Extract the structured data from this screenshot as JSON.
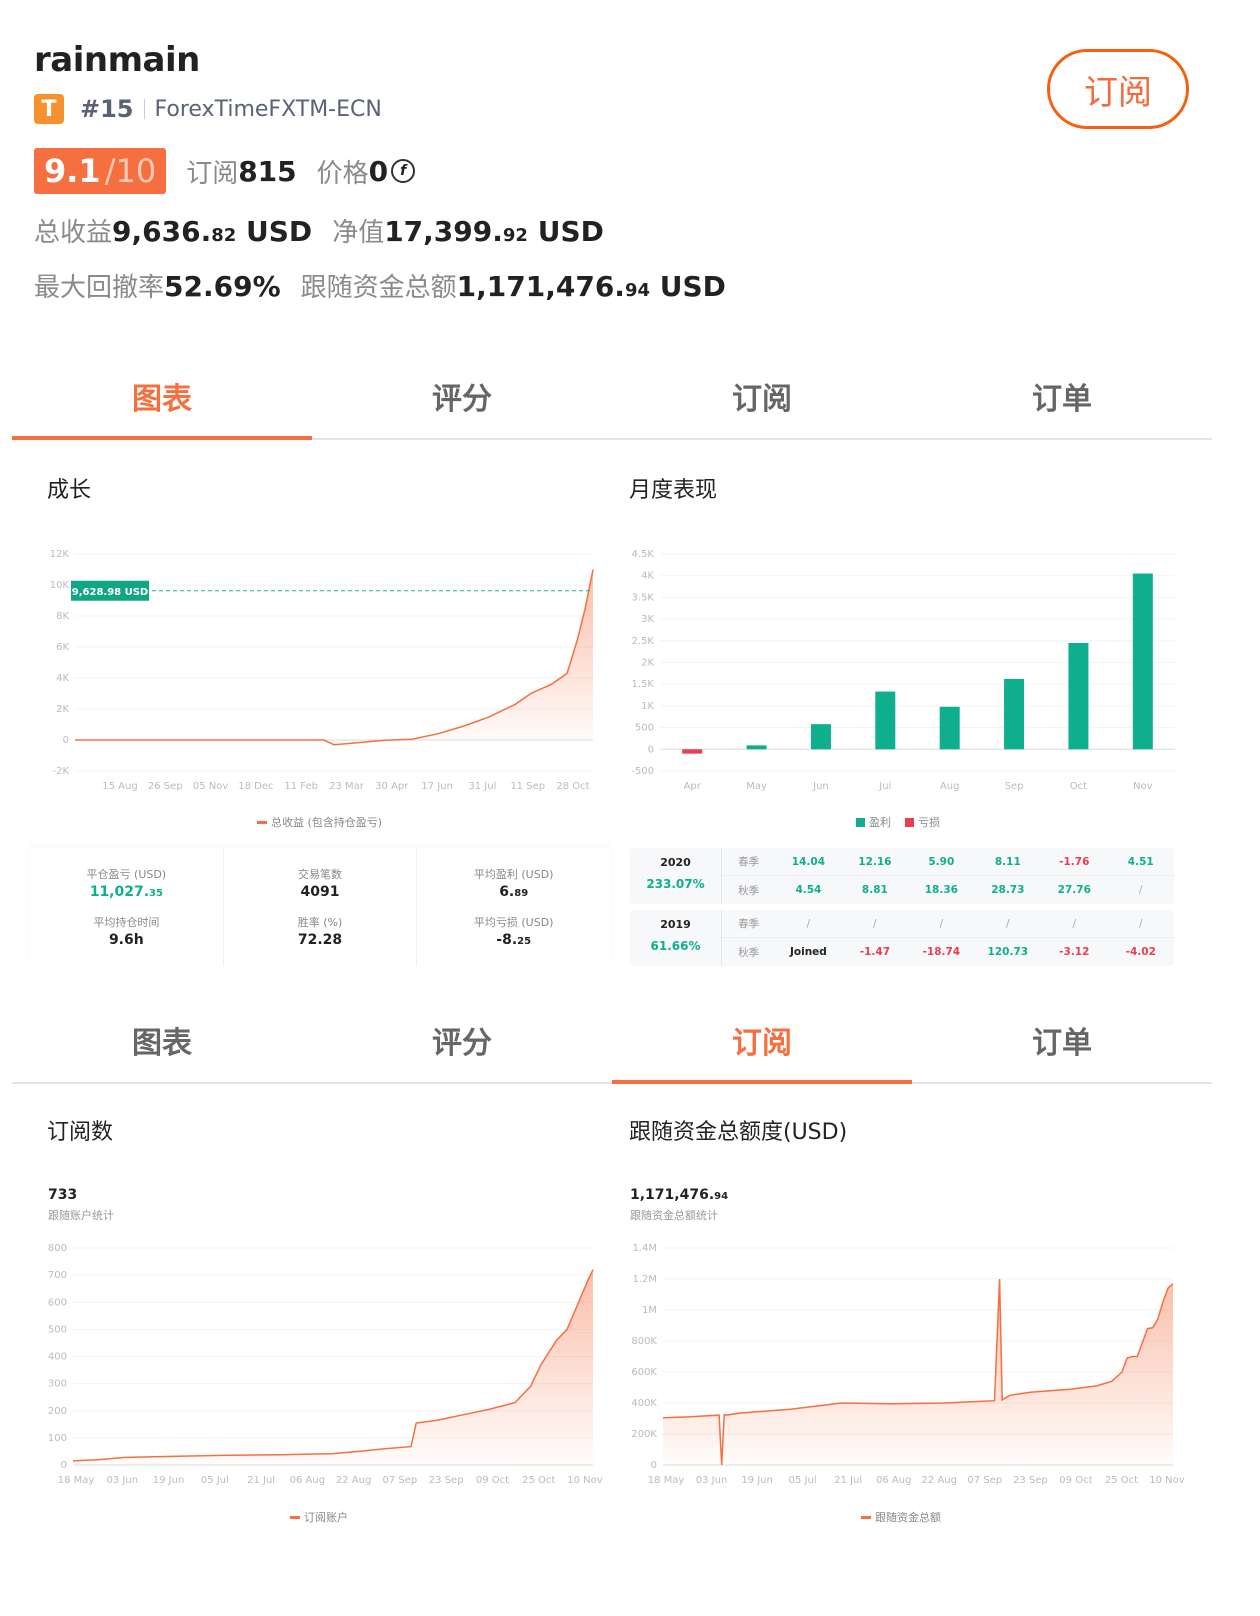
{
  "profile": {
    "username": "rainmain",
    "tier_badge": "T",
    "rank": "#15",
    "broker": "ForexTimeFXTM-ECN",
    "score": "9.1",
    "score_max": "/10",
    "subscribers_label": "订阅",
    "subscribers": "815",
    "price_label": "价格",
    "price": "0",
    "coin_icon": "f",
    "total_profit_label": "总收益",
    "total_profit_int": "9,636.",
    "total_profit_dec": "82",
    "total_profit_unit": "USD",
    "equity_label": "净值",
    "equity_int": "17,399.",
    "equity_dec": "92",
    "equity_unit": "USD",
    "max_drawdown_label": "最大回撤率",
    "max_drawdown": "52.69%",
    "follow_funds_label": "跟随资金总额",
    "follow_funds_int": "1,171,476.",
    "follow_funds_dec": "94",
    "follow_funds_unit": "USD"
  },
  "subscribe_button": "订阅",
  "tabs_top": [
    {
      "label": "图表",
      "active": true
    },
    {
      "label": "评分",
      "active": false
    },
    {
      "label": "订阅",
      "active": false
    },
    {
      "label": "订单",
      "active": false
    }
  ],
  "tabs_bottom": [
    {
      "label": "图表",
      "active": false
    },
    {
      "label": "评分",
      "active": false
    },
    {
      "label": "订阅",
      "active": true
    },
    {
      "label": "订单",
      "active": false
    }
  ],
  "sections": {
    "growth": "成长",
    "monthly": "月度表现",
    "subscriptions": "订阅数",
    "follow_funds": "跟随资金总额度(USD)"
  },
  "colors": {
    "accent": "#f56f40",
    "profit": "#0fae8d",
    "loss": "#ea3e4f"
  },
  "summary": [
    {
      "label": "平仓盈亏 (USD)",
      "int": "11,027.",
      "dec": "35",
      "green": true
    },
    {
      "label": "交易笔数",
      "int": "4091",
      "dec": ""
    },
    {
      "label": "平均盈利 (USD)",
      "int": "6.",
      "dec": "89"
    },
    {
      "label": "平均持仓时间",
      "int": "9.6h",
      "dec": ""
    },
    {
      "label": "胜率 (%)",
      "int": "72.28",
      "dec": ""
    },
    {
      "label": "平均亏损 (USD)",
      "int": "-8.",
      "dec": "25"
    }
  ],
  "yearly": [
    {
      "year": "2020",
      "return": "233.07%",
      "rows": [
        {
          "season": "春季",
          "values": [
            "14.04",
            "12.16",
            "5.90",
            "8.11",
            "-1.76",
            "4.51"
          ]
        },
        {
          "season": "秋季",
          "values": [
            "4.54",
            "8.81",
            "18.36",
            "28.73",
            "27.76",
            "/"
          ]
        }
      ]
    },
    {
      "year": "2019",
      "return": "61.66%",
      "rows": [
        {
          "season": "春季",
          "values": [
            "/",
            "/",
            "/",
            "/",
            "/",
            "/"
          ]
        },
        {
          "season": "秋季",
          "values": [
            "Joined",
            "-1.47",
            "-18.74",
            "120.73",
            "-3.12",
            "-4.02"
          ]
        }
      ]
    }
  ],
  "subs_stats": {
    "value": "733",
    "label": "跟随账户统计"
  },
  "funds_stats": {
    "int": "1,171,476.",
    "dec": "94",
    "label": "跟随资金总额统计"
  },
  "chart_data": [
    {
      "type": "area",
      "title": "成长",
      "series": [
        {
          "name": "总收益 (包含持仓盈亏)",
          "x": [
            0,
            0.48,
            0.5,
            0.52,
            0.6,
            0.65,
            0.7,
            0.75,
            0.8,
            0.85,
            0.88,
            0.92,
            0.95,
            0.97,
            0.985,
            1.0
          ],
          "values": [
            0,
            0,
            -300,
            -250,
            -10,
            50,
            400,
            900,
            1500,
            2300,
            3000,
            3600,
            4300,
            6500,
            8500,
            11000
          ]
        }
      ],
      "x_tick_labels": [
        "15 Aug",
        "26 Sep",
        "05 Nov",
        "18 Dec",
        "11 Feb",
        "23 Mar",
        "30 Apr",
        "17 Jun",
        "31 Jul",
        "11 Sep",
        "28 Oct"
      ],
      "y_tick_labels": [
        "12K",
        "10K",
        "8K",
        "6K",
        "4K",
        "2K",
        "0",
        "-2K"
      ],
      "ylim": [
        -2000,
        12000
      ],
      "annotation": {
        "label": "9,628.98 USD",
        "value": 9628.98
      },
      "legend": "bottom"
    },
    {
      "type": "bar",
      "title": "月度表现",
      "categories": [
        "Apr",
        "May",
        "Jun",
        "Jul",
        "Aug",
        "Sep",
        "Oct",
        "Nov"
      ],
      "values": [
        -100,
        90,
        580,
        1330,
        980,
        1620,
        2450,
        4050
      ],
      "y_tick_labels": [
        "4.5K",
        "4K",
        "3.5K",
        "3K",
        "2.5K",
        "2K",
        "1.5K",
        "1K",
        "500",
        "0",
        "-500"
      ],
      "ylim": [
        -500,
        4500
      ],
      "legend_items": [
        {
          "name": "盈利",
          "color": "#0fae8d"
        },
        {
          "name": "亏损",
          "color": "#ea3e4f"
        }
      ],
      "legend": "bottom"
    },
    {
      "type": "area",
      "title": "订阅数",
      "series": [
        {
          "name": "订阅账户",
          "x": [
            0,
            0.05,
            0.1,
            0.2,
            0.3,
            0.4,
            0.5,
            0.55,
            0.6,
            0.65,
            0.66,
            0.7,
            0.75,
            0.8,
            0.85,
            0.88,
            0.9,
            0.93,
            0.95,
            0.97,
            0.99,
            1.0
          ],
          "values": [
            15,
            20,
            28,
            32,
            36,
            38,
            42,
            50,
            60,
            68,
            155,
            165,
            185,
            205,
            230,
            290,
            370,
            460,
            500,
            590,
            680,
            720
          ]
        }
      ],
      "x_tick_labels": [
        "18 May",
        "03 Jun",
        "19 Jun",
        "05 Jul",
        "21 Jul",
        "06 Aug",
        "22 Aug",
        "07 Sep",
        "23 Sep",
        "09 Oct",
        "25 Oct",
        "10 Nov"
      ],
      "y_tick_labels": [
        "800",
        "700",
        "600",
        "500",
        "400",
        "300",
        "200",
        "100",
        "0"
      ],
      "ylim": [
        0,
        800
      ],
      "legend": "bottom"
    },
    {
      "type": "area",
      "title": "跟随资金总额度(USD)",
      "series": [
        {
          "name": "跟随资金总额",
          "x": [
            0,
            0.05,
            0.11,
            0.115,
            0.12,
            0.125,
            0.15,
            0.25,
            0.35,
            0.45,
            0.55,
            0.65,
            0.66,
            0.665,
            0.67,
            0.68,
            0.72,
            0.8,
            0.85,
            0.88,
            0.9,
            0.91,
            0.92,
            0.93,
            0.95,
            0.96,
            0.97,
            0.98,
            0.99,
            1.0
          ],
          "values": [
            305000,
            310000,
            322000,
            0,
            325000,
            322000,
            335000,
            360000,
            400000,
            395000,
            400000,
            415000,
            1200000,
            420000,
            430000,
            450000,
            470000,
            490000,
            510000,
            540000,
            600000,
            690000,
            700000,
            700000,
            880000,
            885000,
            940000,
            1050000,
            1140000,
            1170000
          ]
        }
      ],
      "x_tick_labels": [
        "18 May",
        "03 Jun",
        "19 Jun",
        "05 Jul",
        "21 Jul",
        "06 Aug",
        "22 Aug",
        "07 Sep",
        "23 Sep",
        "09 Oct",
        "25 Oct",
        "10 Nov"
      ],
      "y_tick_labels": [
        "1.4M",
        "1.2M",
        "1M",
        "800K",
        "600K",
        "400K",
        "200K",
        "0"
      ],
      "ylim": [
        0,
        1400000
      ],
      "legend": "bottom"
    }
  ]
}
